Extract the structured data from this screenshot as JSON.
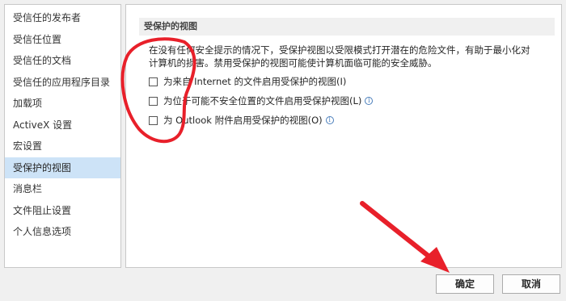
{
  "nav": {
    "items": [
      {
        "label": "受信任的发布者"
      },
      {
        "label": "受信任位置"
      },
      {
        "label": "受信任的文档"
      },
      {
        "label": "受信任的应用程序目录"
      },
      {
        "label": "加载项"
      },
      {
        "label": "ActiveX 设置"
      },
      {
        "label": "宏设置"
      },
      {
        "label": "受保护的视图"
      },
      {
        "label": "消息栏"
      },
      {
        "label": "文件阻止设置"
      },
      {
        "label": "个人信息选项"
      }
    ],
    "selected_index": 7
  },
  "panel": {
    "section_title": "受保护的视图",
    "description_line1": "在没有任何安全提示的情况下，受保护视图以受限模式打开潜在的危险文件，有助于最小化对",
    "description_line2": "计算机的损害。禁用受保护的视图可能使计算机面临可能的安全威胁。",
    "options": [
      {
        "label": "为来自 Internet 的文件启用受保护的视图(I)",
        "checked": false,
        "info": false
      },
      {
        "label": "为位于可能不安全位置的文件启用受保护视图(L)",
        "checked": false,
        "info": true
      },
      {
        "label": "为 Outlook 附件启用受保护的视图(O)",
        "checked": false,
        "info": true
      }
    ]
  },
  "buttons": {
    "ok_label": "确定",
    "cancel_label": "取消"
  },
  "colors": {
    "annotation": "#e8202a",
    "selected_bg": "#cde3f7",
    "info_icon": "#4a7ebb"
  },
  "icons": {
    "info": "info-icon"
  }
}
